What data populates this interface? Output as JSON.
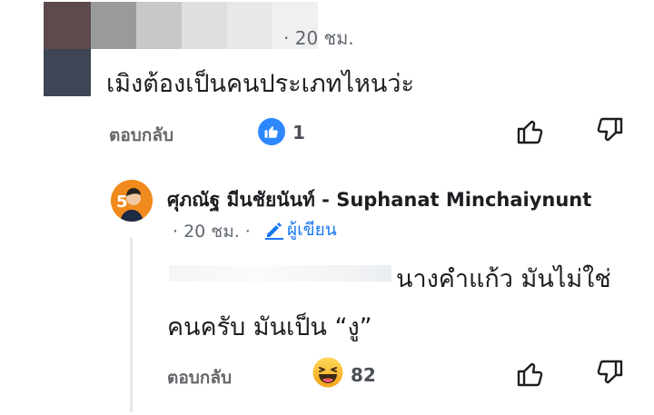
{
  "comment_top": {
    "time": "· 20 ชม.",
    "text": "เมิงต้องเป็นคนประเภทไหนว่ะ",
    "reply_label": "ตอบกลับ",
    "reaction_count": "1",
    "reaction_icon": "like-icon"
  },
  "reply": {
    "avatar_badge": "5",
    "author": "ศุภณัฐ มีนชัยนันท์ - Suphanat Minchaiynunt",
    "time": "· 20 ชม. ·",
    "author_badge": "ผู้เขียน",
    "text_line1": "นางคำแก้ว มันไม่ใช่",
    "text_line2": "คนครับ มันเป็น “งู”",
    "reply_label": "ตอบกลับ",
    "reaction_count": "82",
    "reaction_icon": "laugh-icon"
  },
  "colors": {
    "accent": "#1877f2",
    "like_blue": "#2d88ff",
    "avatar_orange": "#f08a1c",
    "muted": "#65676b"
  }
}
